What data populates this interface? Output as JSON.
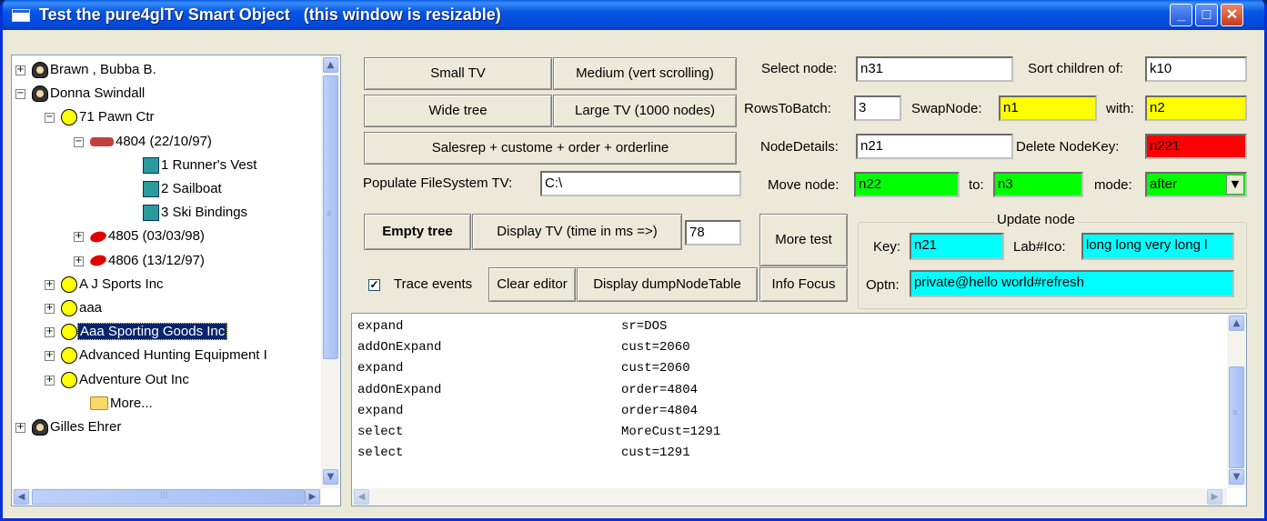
{
  "window": {
    "title": "Test the pure4glTv Smart Object   (this window is resizable)",
    "minimize_label": "_",
    "maximize_label": "□",
    "close_label": "✕"
  },
  "tree": {
    "nodes": [
      {
        "label": "Brawn , Bubba B.",
        "expander": "+",
        "icon": "person-icon"
      },
      {
        "label": "Donna Swindall",
        "expander": "−",
        "icon": "person-icon"
      },
      {
        "label": "71 Pawn Ctr",
        "expander": "−",
        "icon": "smiley-icon"
      },
      {
        "label": "4804 (22/10/97)",
        "expander": "−",
        "icon": "book-icon"
      },
      {
        "label": "1  Runner's Vest",
        "expander": "",
        "icon": "gift-icon"
      },
      {
        "label": "2  Sailboat",
        "expander": "",
        "icon": "gift-icon"
      },
      {
        "label": "3  Ski Bindings",
        "expander": "",
        "icon": "gift-icon"
      },
      {
        "label": "4805 (03/03/98)",
        "expander": "+",
        "icon": "red-leaf-icon"
      },
      {
        "label": "4806 (13/12/97)",
        "expander": "+",
        "icon": "red-leaf-icon"
      },
      {
        "label": "A J Sports Inc",
        "expander": "+",
        "icon": "smiley-icon"
      },
      {
        "label": "aaa",
        "expander": "+",
        "icon": "smiley-icon"
      },
      {
        "label": "Aaa Sporting Goods Inc",
        "expander": "+",
        "icon": "smiley-icon",
        "selected": true
      },
      {
        "label": "Advanced Hunting Equipment I",
        "expander": "+",
        "icon": "smiley-icon"
      },
      {
        "label": "Adventure Out Inc",
        "expander": "+",
        "icon": "smiley-icon"
      },
      {
        "label": "More...",
        "expander": "",
        "icon": "folder-icon"
      },
      {
        "label": "Gilles Ehrer",
        "expander": "+",
        "icon": "person-icon"
      }
    ]
  },
  "buttons": {
    "small_tv": "Small TV",
    "medium": "Medium (vert scrolling)",
    "wide_tree": "Wide tree",
    "large_tv": "Large TV (1000 nodes)",
    "salesrep": "Salesrep + custome + order + orderline",
    "empty_tree": "Empty tree",
    "display_tv": "Display TV  (time in ms =>)",
    "more_test": "More test",
    "clear_editor": "Clear editor",
    "display_dump": "Display dumpNodeTable",
    "info_focus": "Info Focus"
  },
  "populate_fs": {
    "label": "Populate FileSystem TV:",
    "value": "C:\\"
  },
  "display_time": {
    "value": "78"
  },
  "trace": {
    "label": "Trace events",
    "checked": "✓"
  },
  "controls": {
    "select_node_label": "Select node:",
    "select_node_value": "n31",
    "sort_children_label": "Sort children of:",
    "sort_children_value": "k10",
    "rows_to_batch_label": "RowsToBatch:",
    "rows_to_batch_value": "3",
    "swap_node_label": "SwapNode:",
    "swap_node_value": "n1",
    "with_label": "with:",
    "with_value": "n2",
    "node_details_label": "NodeDetails:",
    "node_details_value": "n21",
    "delete_node_label": "Delete NodeKey:",
    "delete_node_value": "n221",
    "move_node_label": "Move node:",
    "move_node_value": "n22",
    "to_label": "to:",
    "to_value": "n3",
    "mode_label": "mode:",
    "mode_value": "after"
  },
  "update_node": {
    "legend": "Update node",
    "key_label": "Key:",
    "key_value": "n21",
    "labico_label": "Lab#Ico:",
    "labico_value": "long long very long l",
    "optn_label": "Optn:",
    "optn_value": "private@hello world#refresh"
  },
  "editor": {
    "lines": [
      {
        "event": "expand",
        "detail": "sr=DOS"
      },
      {
        "event": "addOnExpand",
        "detail": "cust=2060"
      },
      {
        "event": "expand",
        "detail": "cust=2060"
      },
      {
        "event": "addOnExpand",
        "detail": "order=4804"
      },
      {
        "event": "expand",
        "detail": "order=4804"
      },
      {
        "event": "select",
        "detail": "MoreCust=1291"
      },
      {
        "event": "select",
        "detail": "cust=1291"
      }
    ]
  },
  "colors": {
    "yellow_field": "#ffff00",
    "red_field": "#ff0000",
    "green_field": "#00ff00",
    "cyan_field": "#00ffff",
    "selection": "#0a246a"
  },
  "scrollbar": {
    "thumb_grip": "≡",
    "h_grip": "⁞⁞⁞"
  }
}
